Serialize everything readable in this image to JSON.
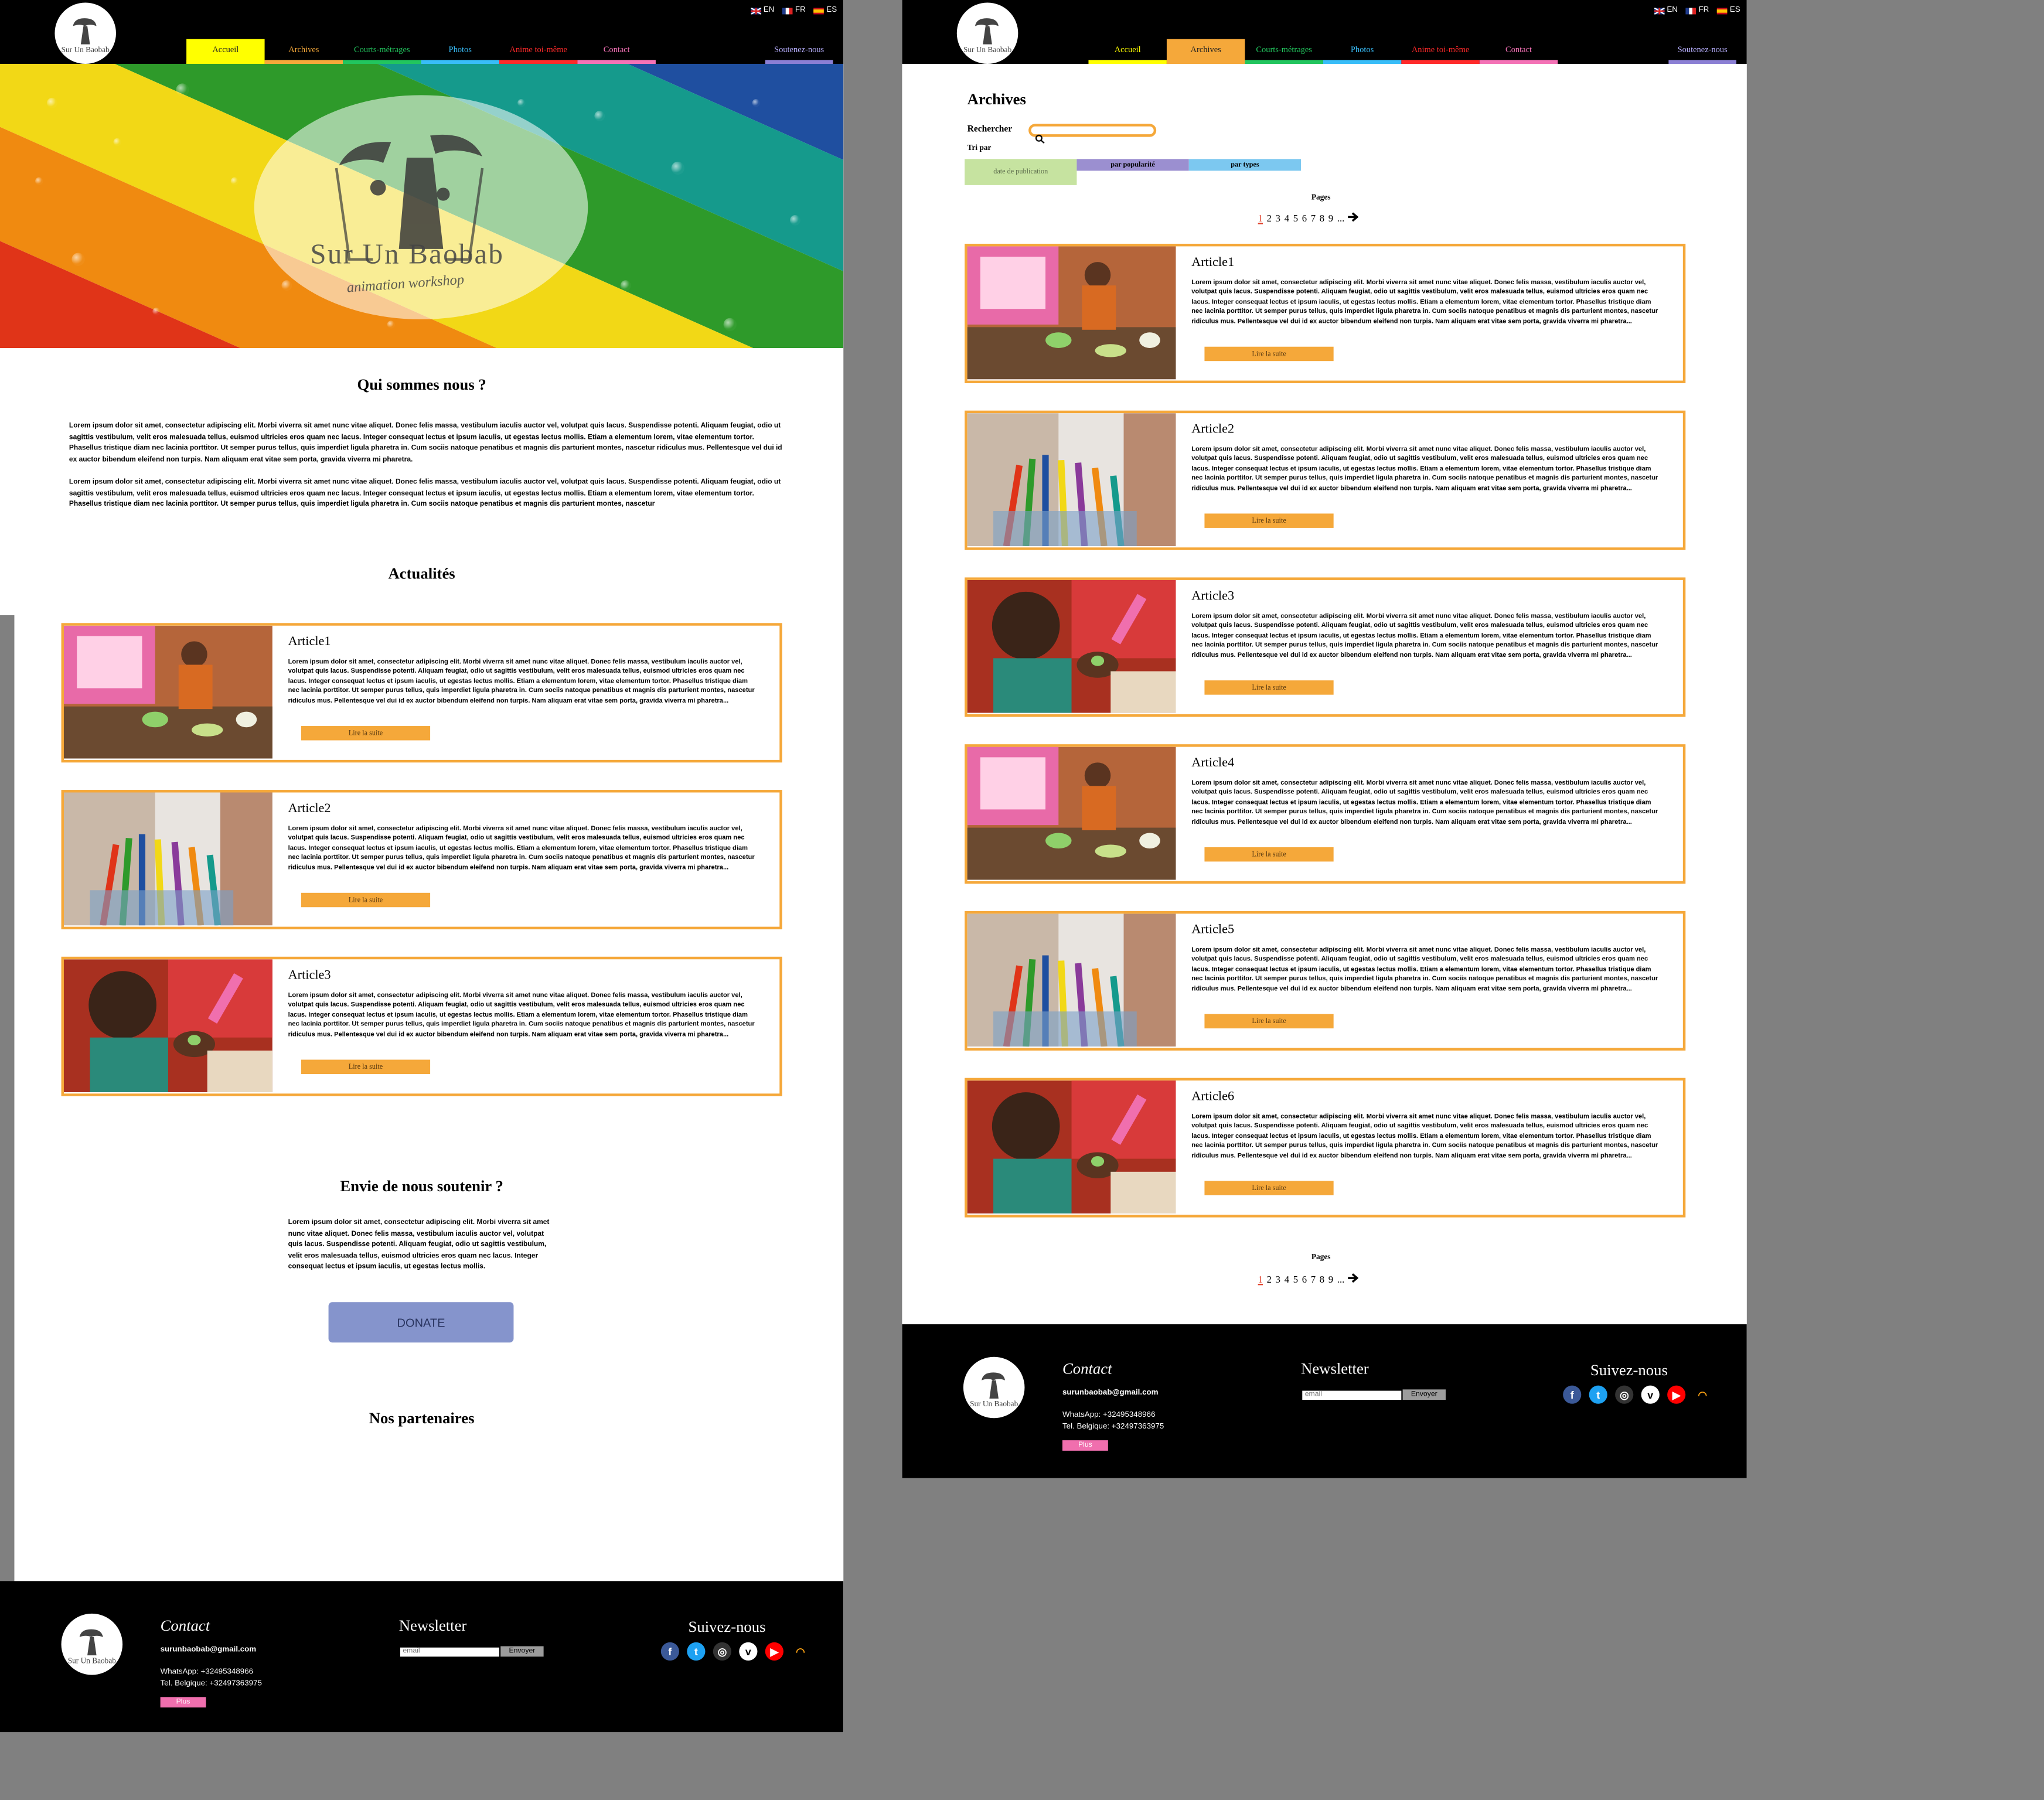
{
  "langs": [
    "EN",
    "FR",
    "ES"
  ],
  "nav": [
    {
      "label": "Accueil",
      "color": "#ffff00"
    },
    {
      "label": "Archives",
      "color": "#f5a83a"
    },
    {
      "label": "Courts-métrages",
      "color": "#22c55e"
    },
    {
      "label": "Photos",
      "color": "#38bdf8"
    },
    {
      "label": "Anime toi-même",
      "color": "#ff2a2a"
    },
    {
      "label": "Contact",
      "color": "#f472b6"
    }
  ],
  "support_label": "Soutenez-nous",
  "hero": {
    "brand": "Sur Un Baobab",
    "tagline": "animation workshop"
  },
  "home": {
    "about_title": "Qui sommes nous ?",
    "about_p1": "Lorem ipsum dolor sit amet, consectetur adipiscing elit. Morbi viverra sit amet nunc vitae aliquet. Donec felis massa, vestibulum iaculis auctor vel, volutpat quis lacus. Suspendisse potenti. Aliquam feugiat, odio ut sagittis vestibulum, velit eros malesuada tellus, euismod ultricies eros quam nec lacus. Integer consequat lectus et ipsum iaculis, ut egestas lectus mollis. Etiam a elementum lorem, vitae elementum tortor. Phasellus tristique diam nec lacinia porttitor. Ut semper purus tellus, quis imperdiet ligula pharetra in. Cum sociis natoque penatibus et magnis dis parturient montes, nascetur ridiculus mus. Pellentesque vel dui id ex auctor bibendum eleifend non turpis. Nam aliquam erat vitae sem porta, gravida viverra mi pharetra.",
    "about_p2": "Lorem ipsum dolor sit amet, consectetur adipiscing elit. Morbi viverra sit amet nunc vitae aliquet. Donec felis massa, vestibulum iaculis auctor vel, volutpat quis lacus. Suspendisse potenti. Aliquam feugiat, odio ut sagittis vestibulum, velit eros malesuada tellus, euismod ultricies eros quam nec lacus. Integer consequat lectus et ipsum iaculis, ut egestas lectus mollis. Etiam a elementum lorem, vitae elementum tortor. Phasellus tristique diam nec lacinia porttitor. Ut semper purus tellus, quis imperdiet ligula pharetra in. Cum sociis natoque penatibus et magnis dis parturient montes, nascetur",
    "news_title": "Actualités",
    "support_title": "Envie de nous soutenir ?",
    "support_text": "Lorem ipsum dolor sit amet, consectetur adipiscing elit. Morbi viverra sit amet nunc vitae aliquet. Donec felis massa, vestibulum iaculis auctor vel, volutpat quis lacus. Suspendisse potenti. Aliquam feugiat, odio ut sagittis vestibulum, velit eros malesuada tellus, euismod ultricies eros quam nec lacus. Integer consequat lectus et ipsum iaculis, ut egestas lectus mollis.",
    "donate_label": "DONATE",
    "partners_title": "Nos partenaires"
  },
  "article_text": "Lorem ipsum dolor sit amet, consectetur adipiscing elit. Morbi viverra sit amet nunc vitae aliquet. Donec felis massa, vestibulum iaculis auctor vel, volutpat quis lacus. Suspendisse potenti. Aliquam feugiat, odio ut sagittis vestibulum, velit eros malesuada tellus, euismod ultricies eros quam nec lacus. Integer consequat lectus et ipsum iaculis, ut egestas lectus mollis. Etiam a elementum lorem, vitae elementum tortor. Phasellus tristique diam nec lacinia porttitor. Ut semper purus tellus, quis imperdiet ligula pharetra in. Cum sociis natoque penatibus et magnis dis parturient montes, nascetur ridiculus mus. Pellentesque vel dui id ex auctor bibendum eleifend non turpis. Nam aliquam erat vitae sem porta, gravida viverra mi pharetra...",
  "read_more": "Lire la suite",
  "articles": [
    "Article1",
    "Article2",
    "Article3",
    "Article4",
    "Article5",
    "Article6"
  ],
  "archives": {
    "title": "Archives",
    "search_label": "Rechercher",
    "sort_label": "Tri par",
    "sort_options": [
      {
        "label": "date de publication",
        "color": "#c6e3a0"
      },
      {
        "label": "par popularité",
        "color": "#9b8fd0"
      },
      {
        "label": "par types",
        "color": "#7cc8f0"
      }
    ],
    "pages_label": "Pages",
    "pages": [
      "1",
      "2",
      "3",
      "4",
      "5",
      "6",
      "7",
      "8",
      "9",
      "..."
    ],
    "current_page": "1",
    "next_icon": "arrow-right-icon"
  },
  "footer": {
    "contact_title": "Contact",
    "email": "surunbaobab@gmail.com",
    "whatsapp": "WhatsApp: +32495348966",
    "tel": "Tel. Belgique: +32497363975",
    "plus_label": "Plus",
    "newsletter_title": "Newsletter",
    "email_placeholder": "email",
    "send_label": "Envoyer",
    "follow_title": "Suivez-nous",
    "socials": [
      {
        "icon": "facebook-icon",
        "glyph": "f",
        "color": "#3b5998"
      },
      {
        "icon": "twitter-icon",
        "glyph": "t",
        "color": "#1da1f2"
      },
      {
        "icon": "instagram-icon",
        "glyph": "◎",
        "color": "#333333"
      },
      {
        "icon": "vimeo-icon",
        "glyph": "v",
        "color": "#ffffff"
      },
      {
        "icon": "youtube-icon",
        "glyph": "▶",
        "color": "#ff0000"
      },
      {
        "icon": "rss-icon",
        "glyph": "◠",
        "color": "#f39c12"
      }
    ]
  }
}
